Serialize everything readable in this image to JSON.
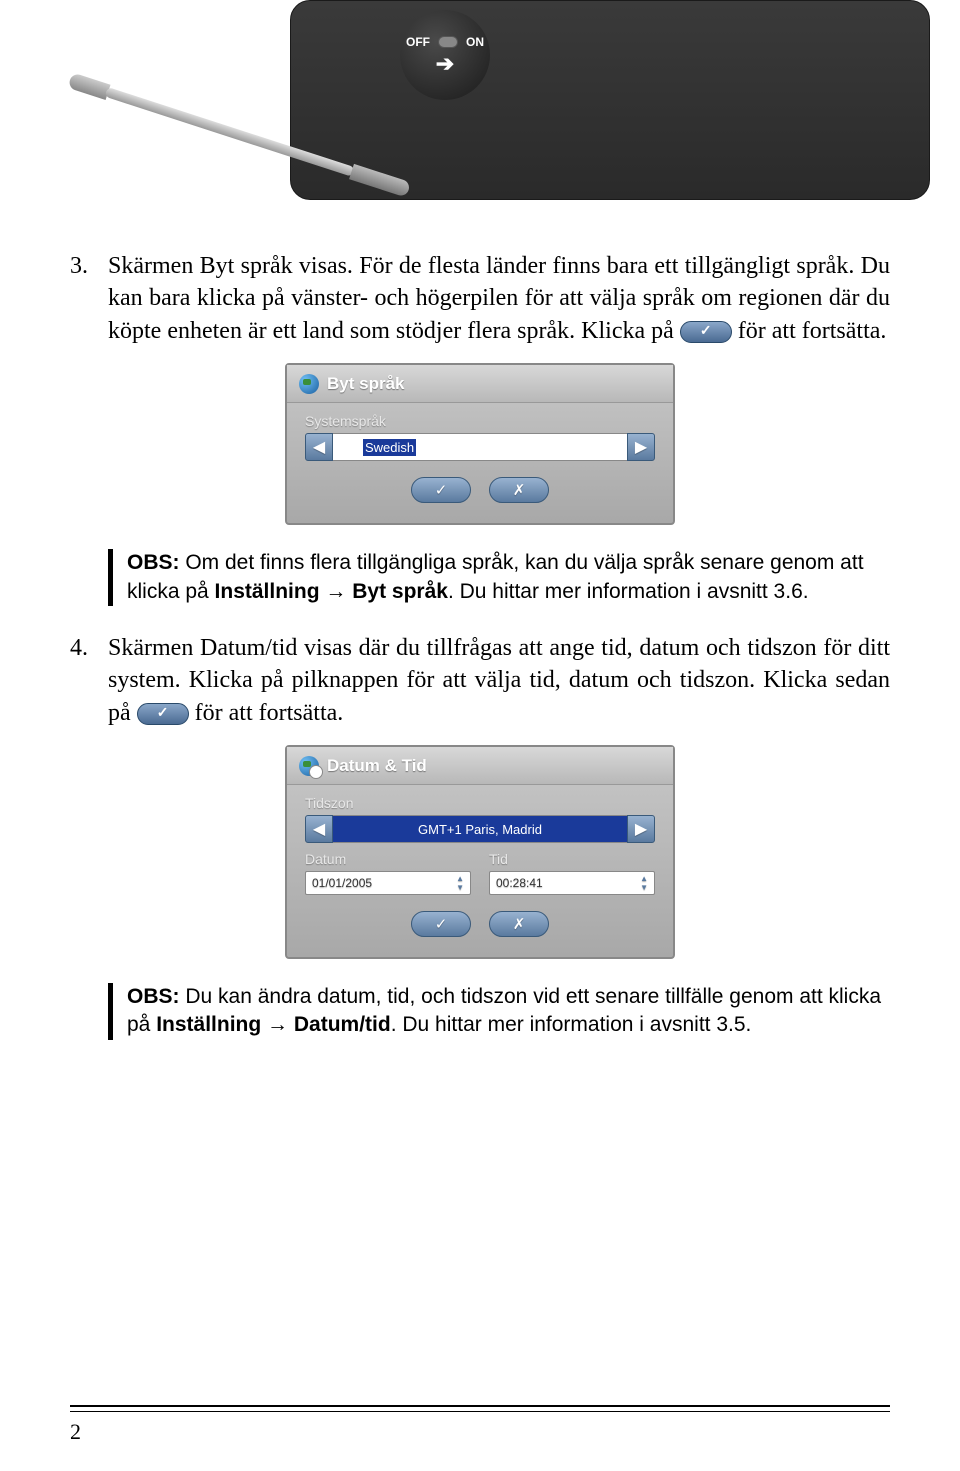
{
  "device": {
    "off_label": "OFF",
    "on_label": "ON"
  },
  "step3": {
    "num": "3.",
    "text_a": "Skärmen Byt språk visas. För de flesta länder finns bara ett tillgängligt språk. Du kan bara klicka på vänster- och högerpilen för att välja språk om regionen där du köpte enheten är ett land som stödjer flera språk. Klicka på ",
    "text_b": " för att fortsätta."
  },
  "dialog1": {
    "title": "Byt språk",
    "label": "Systemspråk",
    "value": "Swedish"
  },
  "note1": {
    "obs": "OBS:",
    "text_a": " Om det finns flera tillgängliga språk, kan du välja språk senare genom att klicka på ",
    "path1": "Inställning",
    "arrow": " → ",
    "path2": "Byt språk",
    "text_b": ". Du hittar mer information i avsnitt 3.6."
  },
  "step4": {
    "num": "4.",
    "text_a": "Skärmen Datum/tid visas där du tillfrågas att ange tid, datum och tidszon för ditt system. Klicka på pilknappen för att välja tid, datum och tidszon. Klicka sedan på ",
    "text_b": " för att fortsätta."
  },
  "dialog2": {
    "title": "Datum & Tid",
    "tz_label": "Tidszon",
    "tz_value": "GMT+1 Paris, Madrid",
    "date_label": "Datum",
    "date_value": "01/01/2005",
    "time_label": "Tid",
    "time_value": "00:28:41"
  },
  "note2": {
    "obs": "OBS:",
    "text_a": " Du kan ändra datum, tid, och tidszon vid ett senare tillfälle genom att klicka på ",
    "path1": "Inställning",
    "arrow": " → ",
    "path2": "Datum/tid",
    "text_b": ". Du hittar mer information i avsnitt 3.5."
  },
  "page_number": "2"
}
